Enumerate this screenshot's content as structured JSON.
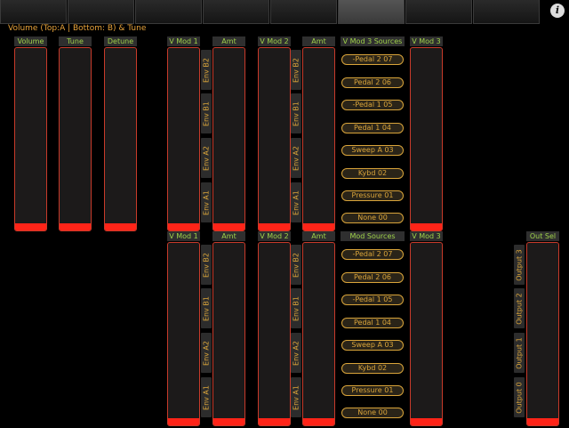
{
  "title": "Volume (Top:A | Bottom: B)  & Tune",
  "info_icon_glyph": "i",
  "left_headers": [
    "Volume",
    "Tune",
    "Detune"
  ],
  "top_panel": {
    "headers": [
      "V Mod 1",
      "Amt",
      "V Mod 2",
      "Amt",
      "V Mod 3 Sources",
      "V Mod 3"
    ],
    "env_labels": [
      "Env B2",
      "Env B1",
      "Env A2",
      "Env A1"
    ],
    "sources": [
      "-Pedal 2 07",
      "Pedal 2 06",
      "-Pedal 1 05",
      "Pedal 1 04",
      "Sweep A 03",
      "Kybd 02",
      "Pressure 01",
      "None 00"
    ]
  },
  "bottom_panel": {
    "headers": [
      "V Mod 1",
      "Amt",
      "V Mod 2",
      "Amt",
      "Mod Sources",
      "V Mod 3"
    ],
    "env_labels": [
      "Env B2",
      "Env B1",
      "Env A2",
      "Env A1"
    ],
    "sources": [
      "-Pedal 2 07",
      "Pedal 2 06",
      "-Pedal 1 05",
      "Pedal 1 04",
      "Sweep A 03",
      "Kybd 02",
      "Pressure 01",
      "None 00"
    ]
  },
  "out_sel": {
    "header": "Out Sel",
    "outputs": [
      "Output 3",
      "Output 2",
      "Output 1",
      "Output 0"
    ]
  },
  "colors": {
    "accent": "#e8a33a",
    "header_text": "#9fd24a",
    "slider_fill": "#ff2418",
    "slider_border": "#c83a2a"
  }
}
